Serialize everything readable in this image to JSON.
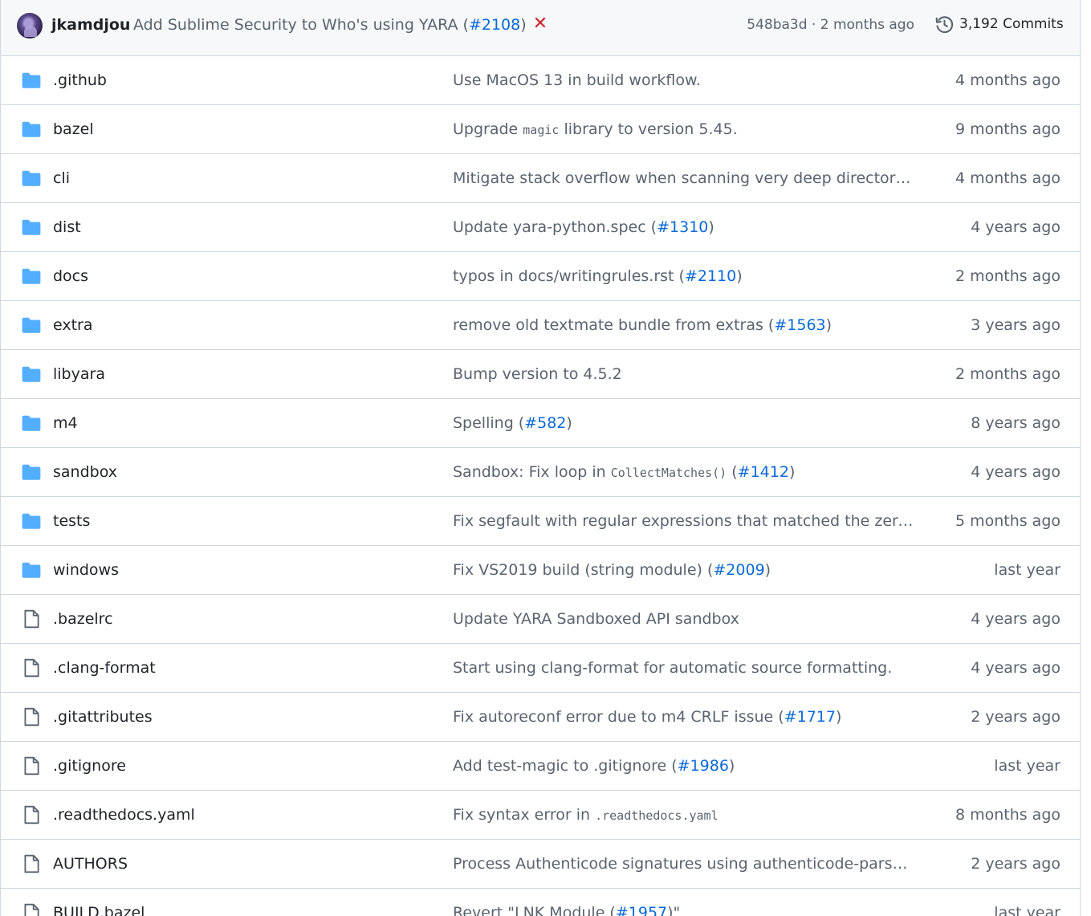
{
  "commit": {
    "author": "jkamdjou",
    "message": "Add Sublime Security to Who's using YARA (",
    "pr": "#2108",
    "message_end": ")",
    "status_icon": "x-icon",
    "status_color": "#d1242f",
    "sha": "548ba3d",
    "time": "2 months ago",
    "commits_label": "3,192 Commits"
  },
  "colors": {
    "folder": "#54aeff",
    "file": "#59636e",
    "link": "#0969da",
    "muted": "#59636e",
    "border": "#d0d7de"
  },
  "files": [
    {
      "type": "folder",
      "name": ".github",
      "age": "4 months ago",
      "msg": [
        {
          "t": "Use MacOS 13 in build workflow."
        }
      ]
    },
    {
      "type": "folder",
      "name": "bazel",
      "age": "9 months ago",
      "msg": [
        {
          "t": "Upgrade "
        },
        {
          "t": "magic",
          "k": "code"
        },
        {
          "t": " library to version 5.45."
        }
      ]
    },
    {
      "type": "folder",
      "name": "cli",
      "age": "4 months ago",
      "msg": [
        {
          "t": "Mitigate stack overflow when scanning very deep directory t..."
        }
      ]
    },
    {
      "type": "folder",
      "name": "dist",
      "age": "4 years ago",
      "msg": [
        {
          "t": "Update yara-python.spec ("
        },
        {
          "t": "#1310",
          "k": "link"
        },
        {
          "t": ")"
        }
      ]
    },
    {
      "type": "folder",
      "name": "docs",
      "age": "2 months ago",
      "msg": [
        {
          "t": "typos in docs/writingrules.rst ("
        },
        {
          "t": "#2110",
          "k": "link"
        },
        {
          "t": ")"
        }
      ]
    },
    {
      "type": "folder",
      "name": "extra",
      "age": "3 years ago",
      "msg": [
        {
          "t": "remove old textmate bundle from extras ("
        },
        {
          "t": "#1563",
          "k": "link"
        },
        {
          "t": ")"
        }
      ]
    },
    {
      "type": "folder",
      "name": "libyara",
      "age": "2 months ago",
      "msg": [
        {
          "t": "Bump version to 4.5.2"
        }
      ]
    },
    {
      "type": "folder",
      "name": "m4",
      "age": "8 years ago",
      "msg": [
        {
          "t": "Spelling ("
        },
        {
          "t": "#582",
          "k": "link"
        },
        {
          "t": ")"
        }
      ]
    },
    {
      "type": "folder",
      "name": "sandbox",
      "age": "4 years ago",
      "msg": [
        {
          "t": "Sandbox: Fix loop in "
        },
        {
          "t": "CollectMatches()",
          "k": "code"
        },
        {
          "t": " ("
        },
        {
          "t": "#1412",
          "k": "link"
        },
        {
          "t": ")"
        }
      ]
    },
    {
      "type": "folder",
      "name": "tests",
      "age": "5 months ago",
      "msg": [
        {
          "t": "Fix segfault with regular expressions that matched the zero-l..."
        }
      ]
    },
    {
      "type": "folder",
      "name": "windows",
      "age": "last year",
      "msg": [
        {
          "t": "Fix VS2019 build (string module) ("
        },
        {
          "t": "#2009",
          "k": "link"
        },
        {
          "t": ")"
        }
      ]
    },
    {
      "type": "file",
      "name": ".bazelrc",
      "age": "4 years ago",
      "msg": [
        {
          "t": "Update YARA Sandboxed API sandbox"
        }
      ]
    },
    {
      "type": "file",
      "name": ".clang-format",
      "age": "4 years ago",
      "msg": [
        {
          "t": "Start using clang-format for automatic source formatting."
        }
      ]
    },
    {
      "type": "file",
      "name": ".gitattributes",
      "age": "2 years ago",
      "msg": [
        {
          "t": "Fix autoreconf error due to m4 CRLF issue ("
        },
        {
          "t": "#1717",
          "k": "link"
        },
        {
          "t": ")"
        }
      ]
    },
    {
      "type": "file",
      "name": ".gitignore",
      "age": "last year",
      "msg": [
        {
          "t": "Add test-magic to .gitignore ("
        },
        {
          "t": "#1986",
          "k": "link"
        },
        {
          "t": ")"
        }
      ]
    },
    {
      "type": "file",
      "name": ".readthedocs.yaml",
      "age": "8 months ago",
      "msg": [
        {
          "t": "Fix syntax error in "
        },
        {
          "t": ".readthedocs.yaml",
          "k": "code"
        }
      ]
    },
    {
      "type": "file",
      "name": "AUTHORS",
      "age": "2 years ago",
      "msg": [
        {
          "t": "Process Authenticode signatures using authenticode-parser ..."
        }
      ]
    },
    {
      "type": "file",
      "name": "BUILD.bazel",
      "age": "last year",
      "msg": [
        {
          "t": "Revert \"LNK Module ("
        },
        {
          "t": "#1957",
          "k": "link"
        },
        {
          "t": ")\""
        }
      ]
    }
  ]
}
